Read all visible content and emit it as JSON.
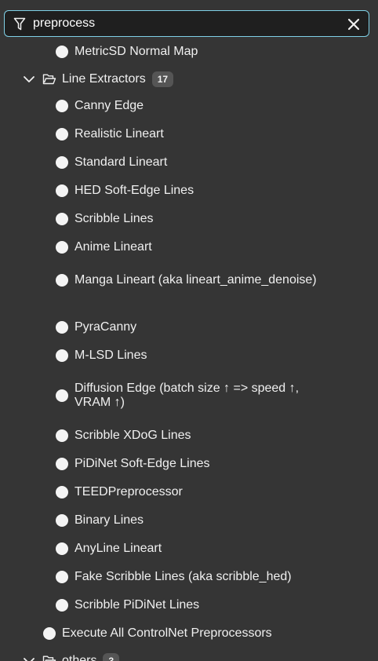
{
  "search": {
    "value": "preprocess",
    "icons": {
      "filter": "filter-icon",
      "clear": "close-icon"
    }
  },
  "tree": {
    "partial_item_above": {
      "label": "MetricSD Normal Map"
    },
    "group": {
      "label": "Line Extractors",
      "count": "17",
      "expanded": true,
      "items": [
        {
          "label": "Canny Edge"
        },
        {
          "label": "Realistic Lineart"
        },
        {
          "label": "Standard Lineart"
        },
        {
          "label": "HED Soft-Edge Lines"
        },
        {
          "label": "Scribble Lines"
        },
        {
          "label": "Anime Lineart"
        },
        {
          "label": "Manga Lineart (aka lineart_anime_denoise)"
        },
        {
          "label": "PyraCanny"
        },
        {
          "label": "M-LSD Lines"
        },
        {
          "label": "Diffusion Edge (batch size ↑ => speed ↑, VRAM ↑)"
        },
        {
          "label": "Scribble XDoG Lines"
        },
        {
          "label": "PiDiNet Soft-Edge Lines"
        },
        {
          "label": "TEEDPreprocessor"
        },
        {
          "label": "Binary Lines"
        },
        {
          "label": "AnyLine Lineart"
        },
        {
          "label": "Fake Scribble Lines (aka scribble_hed)"
        },
        {
          "label": "Scribble PiDiNet Lines"
        }
      ]
    },
    "top_item": {
      "label": "Execute All ControlNet Preprocessors"
    },
    "next_group": {
      "label": "others",
      "count": "3"
    }
  },
  "colors": {
    "background": "#353535",
    "search_background": "#1f1f1f",
    "search_border": "#7fd0e6",
    "badge": "#555555",
    "text": "#f0f0f0"
  }
}
